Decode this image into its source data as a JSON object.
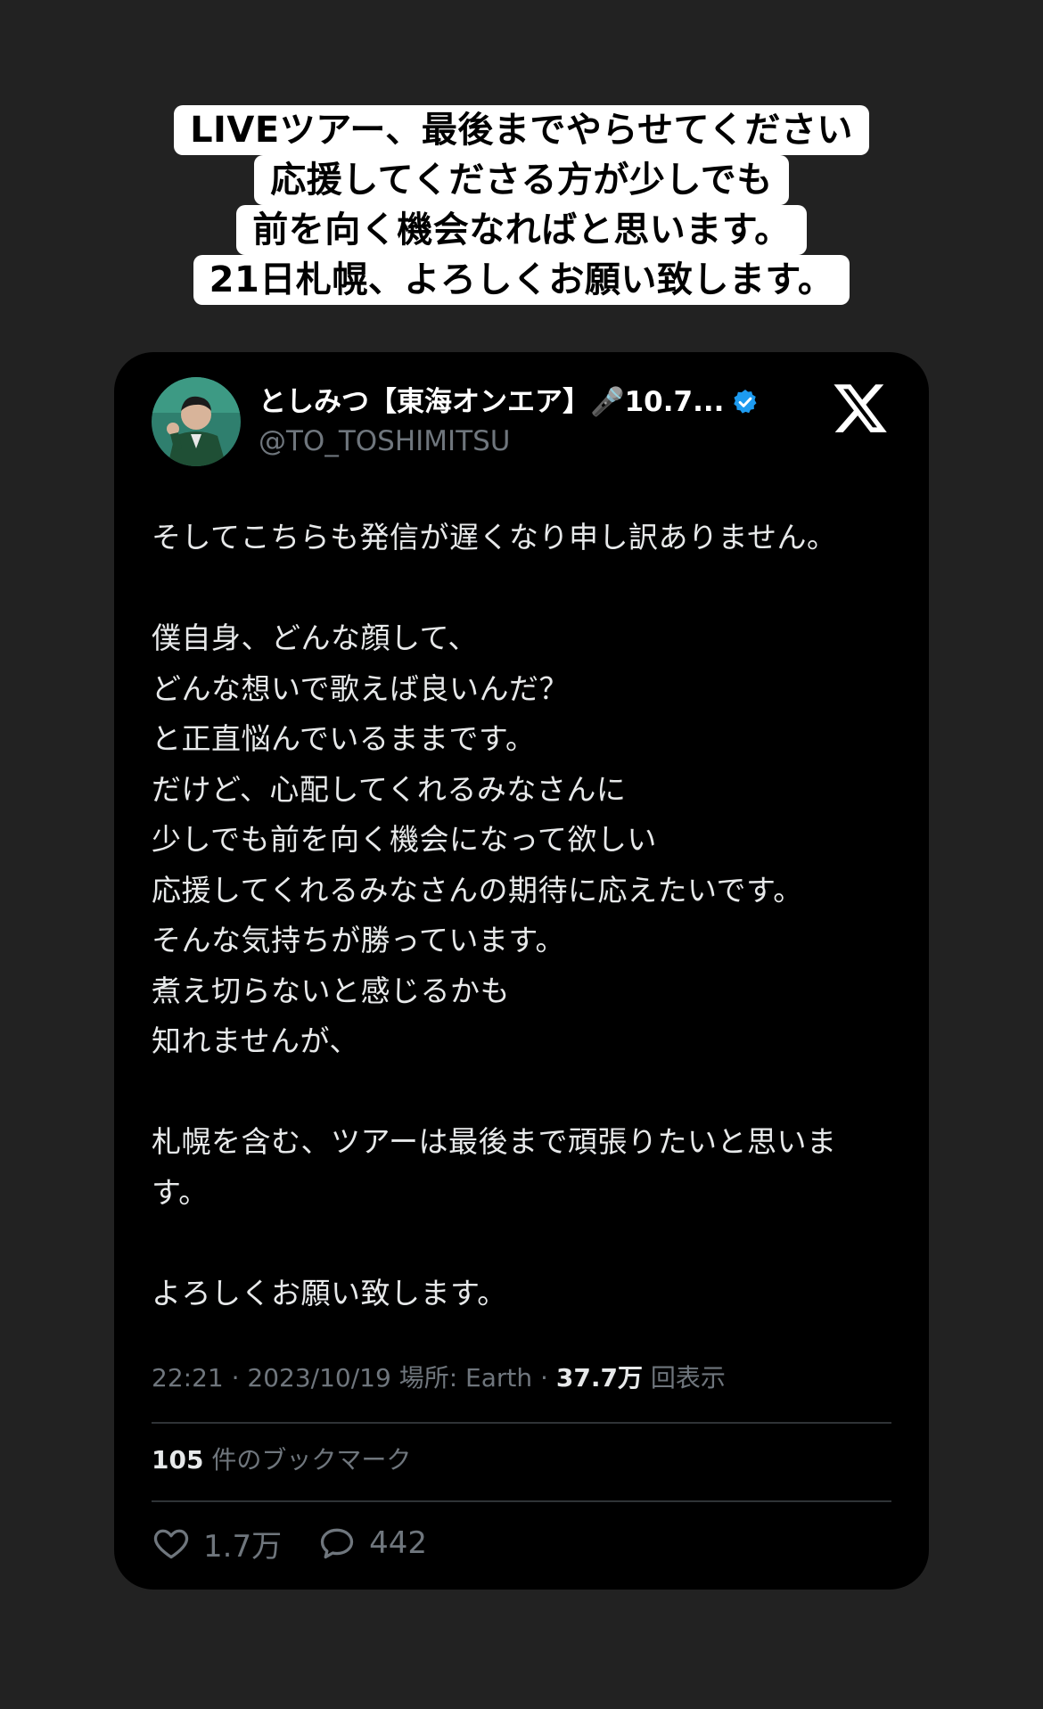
{
  "caption": {
    "lines": [
      "LIVEツアー、最後までやらせてください",
      "応援してくださる方が少しでも",
      "前を向く機会なればと思います。",
      "21日札幌、よろしくお願い致します。"
    ]
  },
  "tweet": {
    "display_name": "としみつ【東海オンエア】🎤10.7...",
    "handle": "@TO_TOSHIMITSU",
    "verified": true,
    "platform_icon": "x-logo-icon",
    "paragraphs": [
      "そしてこちらも発信が遅くなり申し訳ありません。",
      "僕自身、どんな顔して、\nどんな想いで歌えば良いんだ？\nと正直悩んでいるままです。\nだけど、心配してくれるみなさんに\n少しでも前を向く機会になって欲しい\n応援してくれるみなさんの期待に応えたいです。\nそんな気持ちが勝っています。\n煮え切らないと感じるかも\n知れませんが、",
      "札幌を含む、ツアーは最後まで頑張りたいと思いま\nす。",
      "よろしくお願い致します。"
    ],
    "meta": {
      "time": "22:21",
      "date": "2023/10/19",
      "location_label": "場所: Earth",
      "views_count": "37.7万",
      "views_label": "回表示"
    },
    "bookmarks": {
      "count": "105",
      "label": "件のブックマーク"
    },
    "likes": "1.7万",
    "replies": "442"
  },
  "colors": {
    "background": "#222222",
    "card": "#000000",
    "text": "#e7e9ea",
    "muted": "#6f767d",
    "verified": "#1d9bf0"
  }
}
